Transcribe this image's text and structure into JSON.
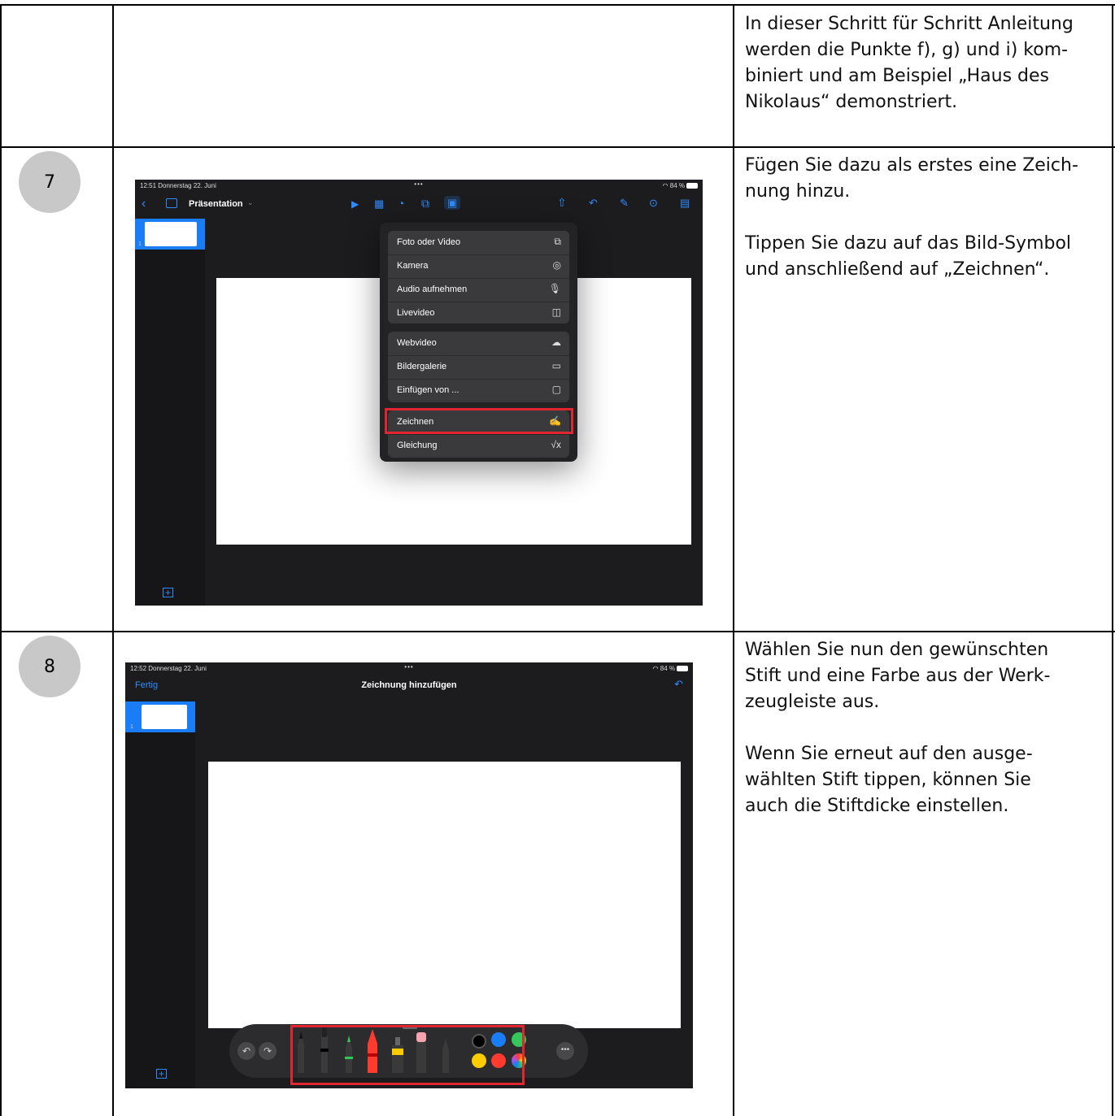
{
  "table": {
    "row0": {
      "text": "In dieser Schritt für Schritt Anleitung\nwerden die Punkte f), g) und i) kom-\nbiniert und am Beispiel „Haus des\nNikolaus“ demonstriert."
    },
    "row1": {
      "step": "7",
      "text": "Fügen Sie dazu als erstes eine Zeich-\nnung hinzu.\n\nTippen Sie dazu auf das Bild-Symbol\nund anschließend auf „Zeichnen“.",
      "screenshot": {
        "status_time": "12:51  Donnerstag 22. Juni",
        "status_dots": "•••",
        "status_battery": "84 %",
        "doc_title": "Präsentation",
        "slide_number": "1",
        "menu_groups": [
          [
            {
              "label": "Foto oder Video",
              "icon": "photo-video-icon"
            },
            {
              "label": "Kamera",
              "icon": "camera-icon"
            },
            {
              "label": "Audio aufnehmen",
              "icon": "microphone-icon"
            },
            {
              "label": "Livevideo",
              "icon": "live-video-icon"
            }
          ],
          [
            {
              "label": "Webvideo",
              "icon": "web-video-icon"
            },
            {
              "label": "Bildergalerie",
              "icon": "image-gallery-icon"
            },
            {
              "label": "Einfügen von ...",
              "icon": "folder-icon"
            }
          ],
          [
            {
              "label": "Zeichnen",
              "icon": "draw-icon"
            },
            {
              "label": "Gleichung",
              "icon": "equation-icon"
            }
          ]
        ],
        "highlighted_item": "Zeichnen"
      }
    },
    "row2": {
      "step": "8",
      "text": "Wählen Sie nun den gewünschten\nStift und eine Farbe aus der Werk-\nzeugleiste aus.\n\nWenn Sie erneut auf den ausge-\nwählten Stift tippen, können Sie\nauch die Stiftdicke einstellen.",
      "screenshot": {
        "status_time": "12:52  Donnerstag 22. Juni",
        "status_dots": "•••",
        "status_battery": "84 %",
        "done_label": "Fertig",
        "title": "Zeichnung hinzufügen",
        "slide_number": "1",
        "colors": [
          "#000000",
          "#1a7df5",
          "#34c759",
          "#ffcc00",
          "#ff3b30",
          "rainbow"
        ]
      }
    }
  },
  "colors": {
    "accent": "#2f8bff",
    "highlight": "#e2262f",
    "badge": "#c8c8c8"
  }
}
